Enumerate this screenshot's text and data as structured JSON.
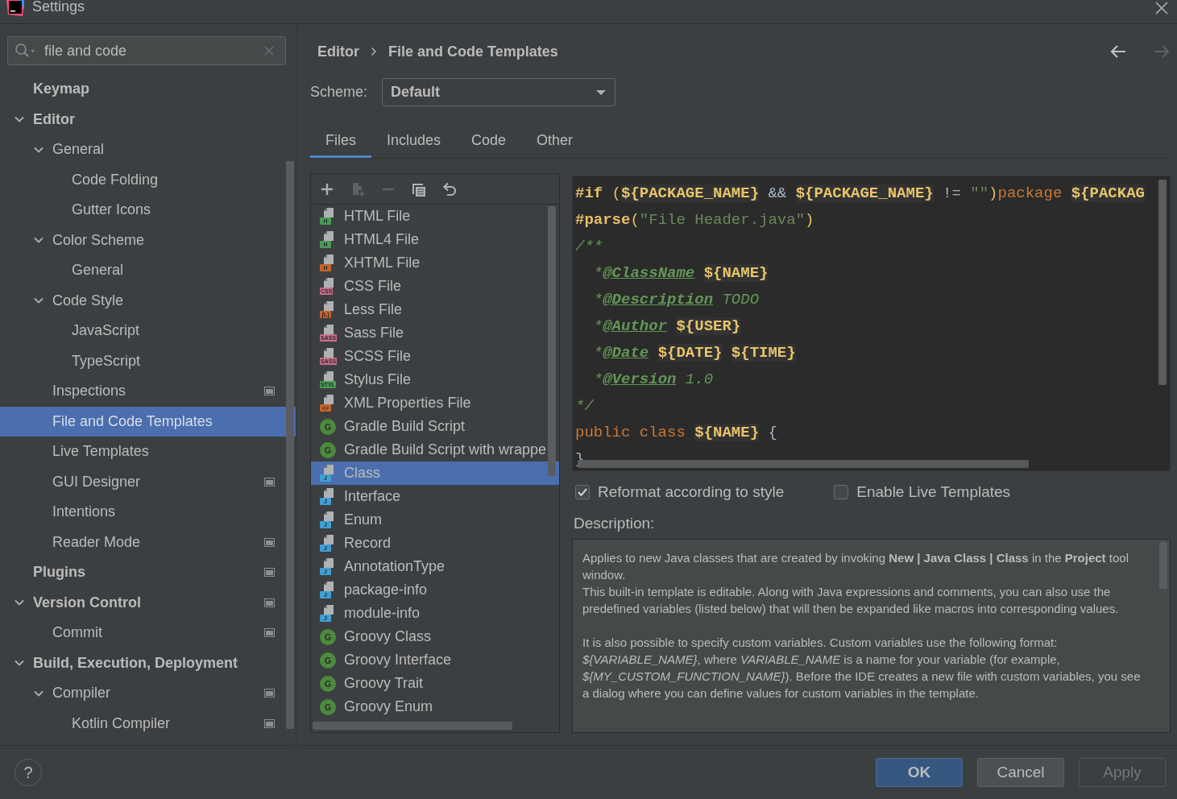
{
  "window": {
    "title": "Settings"
  },
  "sidebar": {
    "search": {
      "value": "file and code"
    },
    "tree": [
      {
        "label": "Keymap",
        "selected": false
      },
      {
        "label": "Editor",
        "selected": false,
        "expanded": true,
        "children": [
          {
            "label": "General",
            "selected": false,
            "expanded": true,
            "children": [
              {
                "label": "Code Folding",
                "selected": false
              },
              {
                "label": "Gutter Icons",
                "selected": false
              }
            ]
          },
          {
            "label": "Color Scheme",
            "selected": false,
            "expanded": true,
            "children": [
              {
                "label": "General",
                "selected": false
              }
            ]
          },
          {
            "label": "Code Style",
            "selected": false,
            "expanded": true,
            "children": [
              {
                "label": "JavaScript",
                "selected": false
              },
              {
                "label": "TypeScript",
                "selected": false
              }
            ]
          },
          {
            "label": "Inspections",
            "selected": false,
            "project_level": true
          },
          {
            "label": "File and Code Templates",
            "selected": true
          },
          {
            "label": "Live Templates",
            "selected": false
          },
          {
            "label": "GUI Designer",
            "selected": false,
            "project_level": true
          },
          {
            "label": "Intentions",
            "selected": false
          },
          {
            "label": "Reader Mode",
            "selected": false,
            "project_level": true
          }
        ]
      },
      {
        "label": "Plugins",
        "selected": false,
        "project_level": true
      },
      {
        "label": "Version Control",
        "selected": false,
        "expanded": true,
        "project_level": true,
        "children": [
          {
            "label": "Commit",
            "selected": false,
            "project_level": true
          }
        ]
      },
      {
        "label": "Build, Execution, Deployment",
        "selected": false,
        "expanded": true,
        "children": [
          {
            "label": "Compiler",
            "selected": false,
            "expanded": true,
            "project_level": true,
            "children": [
              {
                "label": "Kotlin Compiler",
                "selected": false,
                "project_level": true
              }
            ]
          }
        ]
      }
    ]
  },
  "breadcrumb": [
    "Editor",
    "File and Code Templates"
  ],
  "navigation": {
    "back_disabled": false,
    "forward_disabled": true
  },
  "scheme": {
    "label": "Scheme:",
    "value": "Default"
  },
  "tabs": [
    {
      "label": "Files",
      "selected": true
    },
    {
      "label": "Includes",
      "selected": false
    },
    {
      "label": "Code",
      "selected": false
    },
    {
      "label": "Other",
      "selected": false
    }
  ],
  "toolbar": [
    {
      "kind": "add",
      "disabled": false
    },
    {
      "kind": "add-copy",
      "disabled": true
    },
    {
      "kind": "remove",
      "disabled": true
    },
    {
      "kind": "copy",
      "disabled": false
    },
    {
      "kind": "reset",
      "disabled": false
    }
  ],
  "templates": [
    {
      "label": "HTML File",
      "kind": "file",
      "badge": "H",
      "color": "#499c54",
      "selected": false
    },
    {
      "label": "HTML4 File",
      "kind": "file",
      "badge": "H",
      "color": "#499c54",
      "selected": false
    },
    {
      "label": "XHTML File",
      "kind": "file",
      "badge": "H",
      "color": "#c7622a",
      "selected": false
    },
    {
      "label": "CSS File",
      "kind": "file",
      "badge": "CSS",
      "color": "#c9708a",
      "selected": false
    },
    {
      "label": "Less File",
      "kind": "file",
      "badge": "{L}",
      "color": "#c7622a",
      "selected": false
    },
    {
      "label": "Sass File",
      "kind": "file",
      "badge": "SASS",
      "color": "#c9708a",
      "selected": false
    },
    {
      "label": "SCSS File",
      "kind": "file",
      "badge": "SASS",
      "color": "#c9708a",
      "selected": false
    },
    {
      "label": "Stylus File",
      "kind": "file",
      "badge": "STYL",
      "color": "#499c54",
      "selected": false
    },
    {
      "label": "XML Properties File",
      "kind": "file",
      "badge": "<>",
      "color": "#c7622a",
      "selected": false
    },
    {
      "label": "Gradle Build Script",
      "kind": "circle",
      "badge": "G",
      "color": "#4a8b3c",
      "selected": false
    },
    {
      "label": "Gradle Build Script with wrappe",
      "kind": "circle",
      "badge": "G",
      "color": "#4a8b3c",
      "selected": false
    },
    {
      "label": "Class",
      "kind": "file",
      "badge": "J",
      "color": "#3e9fd4",
      "selected": true
    },
    {
      "label": "Interface",
      "kind": "file",
      "badge": "J",
      "color": "#3e9fd4",
      "selected": false
    },
    {
      "label": "Enum",
      "kind": "file",
      "badge": "J",
      "color": "#3e9fd4",
      "selected": false
    },
    {
      "label": "Record",
      "kind": "file",
      "badge": "J",
      "color": "#3e9fd4",
      "selected": false
    },
    {
      "label": "AnnotationType",
      "kind": "file",
      "badge": "J",
      "color": "#3e9fd4",
      "selected": false
    },
    {
      "label": "package-info",
      "kind": "file",
      "badge": "J",
      "color": "#3e9fd4",
      "selected": false
    },
    {
      "label": "module-info",
      "kind": "file",
      "badge": "J",
      "color": "#3e9fd4",
      "selected": false
    },
    {
      "label": "Groovy Class",
      "kind": "circle",
      "badge": "G",
      "color": "#4a8b3c",
      "selected": false
    },
    {
      "label": "Groovy Interface",
      "kind": "circle",
      "badge": "G",
      "color": "#4a8b3c",
      "selected": false
    },
    {
      "label": "Groovy Trait",
      "kind": "circle",
      "badge": "G",
      "color": "#4a8b3c",
      "selected": false
    },
    {
      "label": "Groovy Enum",
      "kind": "circle",
      "badge": "G",
      "color": "#4a8b3c",
      "selected": false
    }
  ],
  "editor": {
    "lines": [
      [
        {
          "kind": "directive",
          "text": "#if"
        },
        {
          "kind": "paren",
          "text": "(",
          "gap": true
        },
        {
          "kind": "var",
          "text": "${PACKAGE_NAME}"
        },
        {
          "kind": "plain",
          "text": " && "
        },
        {
          "kind": "var",
          "text": "${PACKAGE_NAME}"
        },
        {
          "kind": "plain",
          "text": " != "
        },
        {
          "kind": "string",
          "text": "\"\""
        },
        {
          "kind": "paren",
          "text": ")"
        },
        {
          "kind": "keyword",
          "text": "package "
        },
        {
          "kind": "var",
          "text": "${PACKAG"
        }
      ],
      [
        {
          "kind": "directive",
          "text": "#parse"
        },
        {
          "kind": "paren",
          "text": "("
        },
        {
          "kind": "string",
          "text": "\"File Header.java\""
        },
        {
          "kind": "paren",
          "text": ")"
        }
      ],
      [
        {
          "kind": "comment",
          "text": "/**"
        }
      ],
      [
        {
          "kind": "comment",
          "text": "  *"
        },
        {
          "kind": "doctag",
          "text": "@ClassName"
        },
        {
          "kind": "var",
          "text": "${NAME}",
          "gap": true
        }
      ],
      [
        {
          "kind": "comment",
          "text": "  *"
        },
        {
          "kind": "doctag",
          "text": "@Description"
        },
        {
          "kind": "comment",
          "text": " TODO"
        }
      ],
      [
        {
          "kind": "comment",
          "text": "  *"
        },
        {
          "kind": "doctag",
          "text": "@Author"
        },
        {
          "kind": "var",
          "text": "${USER}",
          "gap": true
        }
      ],
      [
        {
          "kind": "comment",
          "text": "  *"
        },
        {
          "kind": "doctag",
          "text": "@Date"
        },
        {
          "kind": "var",
          "text": "${DATE}",
          "gap": true
        },
        {
          "kind": "var",
          "text": "${TIME}",
          "gap": true
        }
      ],
      [
        {
          "kind": "comment",
          "text": "  *"
        },
        {
          "kind": "doctag",
          "text": "@Version"
        },
        {
          "kind": "comment",
          "text": " 1.0"
        }
      ],
      [
        {
          "kind": "comment",
          "text": "*/"
        }
      ],
      [
        {
          "kind": "keyword",
          "text": "public class "
        },
        {
          "kind": "var",
          "text": "${NAME}"
        },
        {
          "kind": "plain",
          "text": " {"
        }
      ],
      [
        {
          "kind": "plain",
          "text": "}"
        }
      ]
    ]
  },
  "options": [
    {
      "label": "Reformat according to style",
      "checked": true
    },
    {
      "label": "Enable Live Templates",
      "checked": false
    }
  ],
  "description": {
    "label": "Description:",
    "paragraphs": [
      "Applies to new Java classes that are created by invoking **New | Java Class | Class** in the **Project** tool window.",
      "This built-in template is editable. Along with Java expressions and comments, you can also use the predefined variables (listed below) that will then be expanded like macros into corresponding values.",
      "It is also possible to specify custom variables. Custom variables use the following format: *${VARIABLE_NAME}*, where *VARIABLE_NAME* is a name for your variable (for example, *${MY_CUSTOM_FUNCTION_NAME}*). Before the IDE creates a new file with custom variables, you see a dialog where you can define values for custom variables in the template."
    ]
  },
  "footer": {
    "help": "?",
    "buttons": [
      {
        "label": "OK",
        "kind": "primary",
        "disabled": false
      },
      {
        "label": "Cancel",
        "kind": "normal",
        "disabled": false
      },
      {
        "label": "Apply",
        "kind": "normal",
        "disabled": true
      }
    ]
  }
}
